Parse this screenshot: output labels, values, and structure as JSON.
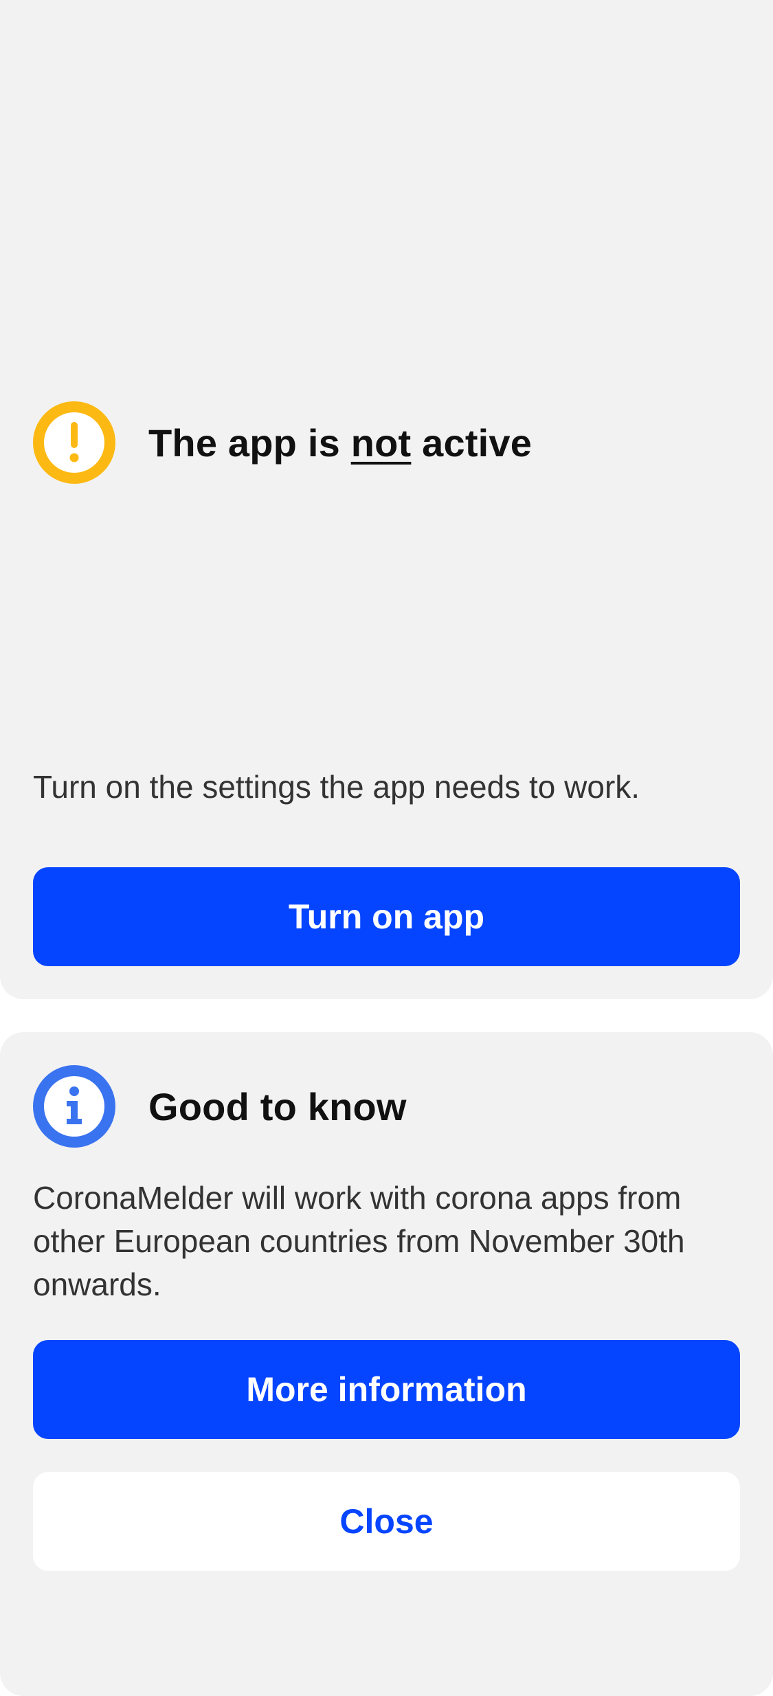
{
  "status_card": {
    "title_prefix": "The app is ",
    "title_emphasis": "not",
    "title_suffix": " active",
    "description": "Turn on the settings the app needs to work.",
    "button_label": "Turn on app",
    "icon": "warning-icon",
    "icon_color": "#fdb913"
  },
  "info_card": {
    "title": "Good to know",
    "description": "CoronaMelder will work with corona apps from other European countries from November 30th onwards.",
    "more_button_label": "More information",
    "close_button_label": "Close",
    "icon": "info-icon",
    "icon_color": "#3a73f0"
  },
  "colors": {
    "primary": "#0645ff",
    "card_background": "#f2f2f2"
  }
}
